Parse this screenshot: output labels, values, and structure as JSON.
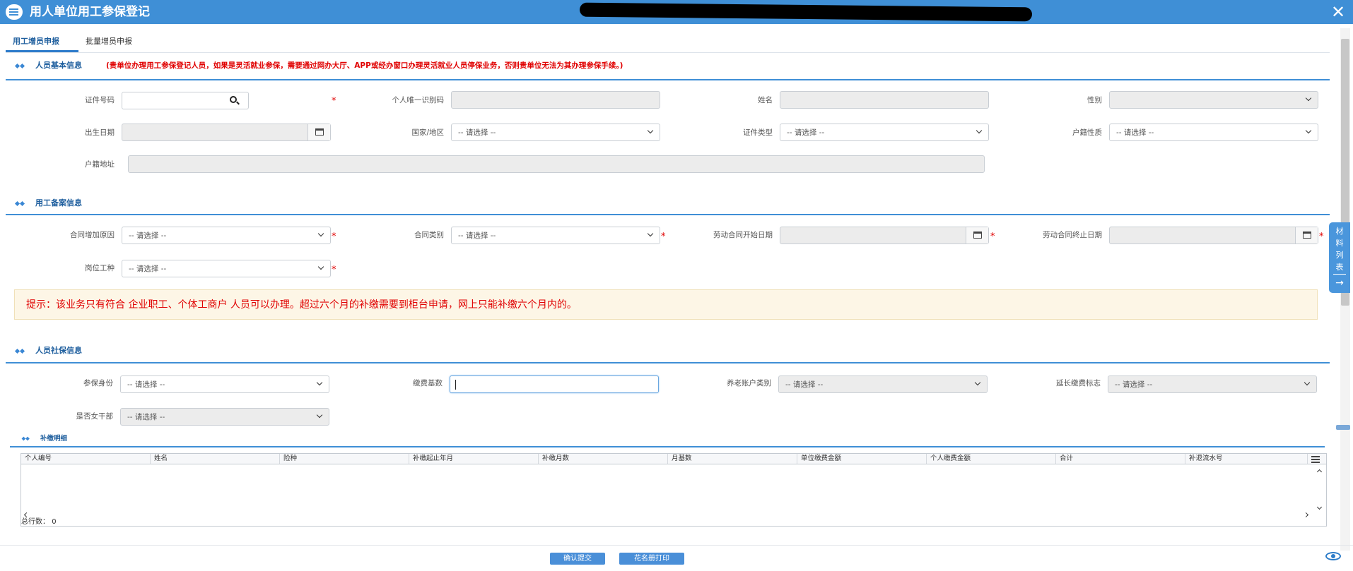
{
  "window": {
    "title": "用人单位用工参保登记",
    "close_glyph": "✕"
  },
  "tabs": [
    {
      "label": "用工增员申报",
      "active": true
    },
    {
      "label": "批量增员申报",
      "active": false
    }
  ],
  "sections": {
    "basic": {
      "title": "人员基本信息",
      "notice": "(贵单位办理用工参保登记人员，如果是灵活就业参保，需要通过网办大厅、APP或经办窗口办理灵活就业人员停保业务，否则贵单位无法为其办理参保手续。)"
    },
    "employment": {
      "title": "用工备案信息"
    },
    "social": {
      "title": "人员社保信息"
    },
    "supplement": {
      "title": "补缴明细"
    }
  },
  "fields": {
    "id_number": {
      "label": "证件号码",
      "value": ""
    },
    "unique_id": {
      "label": "个人唯一识别码",
      "value": ""
    },
    "name": {
      "label": "姓名",
      "value": ""
    },
    "gender": {
      "label": "性别",
      "value": ""
    },
    "birth_date": {
      "label": "出生日期",
      "value": ""
    },
    "country": {
      "label": "国家/地区",
      "value": "-- 请选择 --"
    },
    "id_type": {
      "label": "证件类型",
      "value": "-- 请选择 --"
    },
    "hukou_type": {
      "label": "户籍性质",
      "value": "-- 请选择 --"
    },
    "hukou_address": {
      "label": "户籍地址",
      "value": ""
    },
    "contract_reason": {
      "label": "合同增加原因",
      "value": "-- 请选择 --"
    },
    "contract_type": {
      "label": "合同类别",
      "value": "-- 请选择 --"
    },
    "contract_start": {
      "label": "劳动合同开始日期",
      "value": ""
    },
    "contract_end": {
      "label": "劳动合同终止日期",
      "value": ""
    },
    "position": {
      "label": "岗位工种",
      "value": "-- 请选择 --"
    },
    "insured_identity": {
      "label": "参保身份",
      "value": "-- 请选择 --"
    },
    "contribution_base": {
      "label": "缴费基数",
      "value": ""
    },
    "pension_account_type": {
      "label": "养老账户类别",
      "value": "-- 请选择 --"
    },
    "extended_payment": {
      "label": "延长缴费标志",
      "value": "-- 请选择 --"
    },
    "female_cadre": {
      "label": "是否女干部",
      "value": "-- 请选择 --"
    }
  },
  "required_mark": "*",
  "tip": "提示：该业务只有符合 企业职工、个体工商户 人员可以办理。超过六个月的补缴需要到柜台申请，网上只能补缴六个月内的。",
  "grid": {
    "columns": [
      "个人编号",
      "姓名",
      "险种",
      "补缴起止年月",
      "补缴月数",
      "月基数",
      "单位缴费金额",
      "个人缴费金额",
      "合计",
      "补退流水号"
    ],
    "rows": [],
    "total_label": "总行数：",
    "total_count": "0"
  },
  "side_panel": {
    "label": "材料列表",
    "arrow": "→"
  },
  "buttons": {
    "submit": "确认提交",
    "print": "花名册打印"
  }
}
